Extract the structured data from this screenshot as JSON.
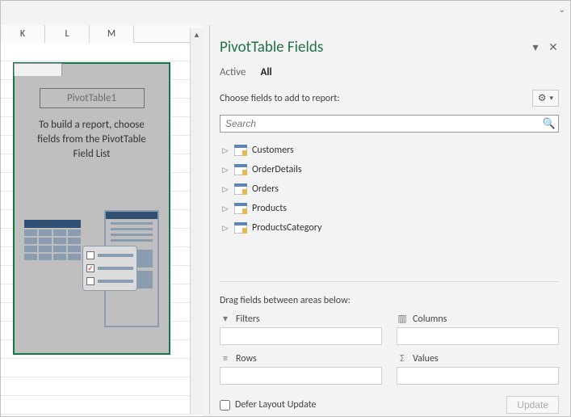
{
  "worksheet": {
    "columns": [
      "K",
      "L",
      "M"
    ]
  },
  "placeholder": {
    "title": "PivotTable1",
    "instruction1": "To build a report, choose",
    "instruction2": "fields from the PivotTable",
    "instruction3": "Field List"
  },
  "pane": {
    "title": "PivotTable Fields",
    "tab_active": "Active",
    "tab_all": "All",
    "choose_label": "Choose fields to add to report:",
    "search_placeholder": "Search",
    "fields": {
      "0": "Customers",
      "1": "OrderDetails",
      "2": "Orders",
      "3": "Products",
      "4": "ProductsCategory"
    },
    "drag_label": "Drag fields between areas below:",
    "areas": {
      "filters": "Filters",
      "columns": "Columns",
      "rows": "Rows",
      "values": "Values"
    },
    "defer_label": "Defer Layout Update",
    "update_btn": "Update"
  }
}
